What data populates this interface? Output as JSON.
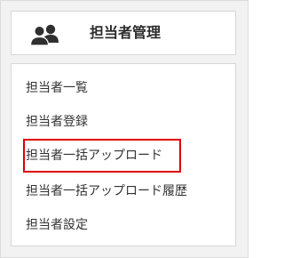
{
  "panel": {
    "title": "担当者管理",
    "icon": "users-icon"
  },
  "menu": {
    "items": [
      {
        "label": "担当者一覧"
      },
      {
        "label": "担当者登録"
      },
      {
        "label": "担当者一括アップロード",
        "highlighted": true
      },
      {
        "label": "担当者一括アップロード履歴"
      },
      {
        "label": "担当者設定"
      }
    ]
  },
  "colors": {
    "highlight_border": "#e00000",
    "background": "#f2f2f2",
    "text": "#333333"
  }
}
